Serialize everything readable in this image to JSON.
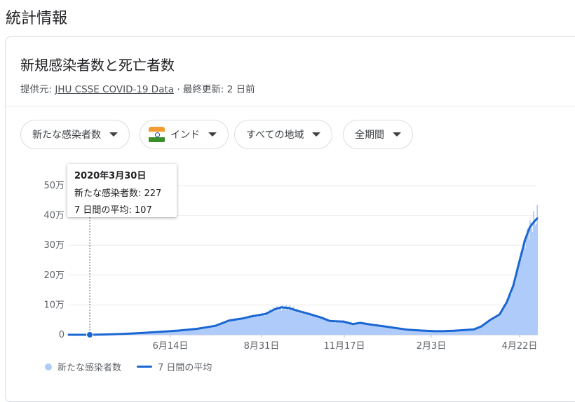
{
  "page": {
    "title": "統計情報"
  },
  "card": {
    "title": "新規感染者数と死亡者数",
    "source_prefix": "提供元: ",
    "source_link": "JHU CSSE COVID-19 Data",
    "source_suffix": " · 最終更新: 2 日前"
  },
  "filters": {
    "metric": "新たな感染者数",
    "country": "インド",
    "region": "すべての地域",
    "period": "全期間"
  },
  "colors": {
    "bars": "#aecbfa",
    "avg_line": "#1a66d2",
    "grid": "#ebebeb",
    "text": "#5f6368"
  },
  "tooltip": {
    "date": "2020年3月30日",
    "new_cases_label": "新たな感染者数",
    "new_cases_value": 227,
    "avg_label": "7 日間の平均",
    "avg_value": 107,
    "new_cases_text": "新たな感染者数: 227",
    "avg_text": "7 日間の平均: 107"
  },
  "legend": {
    "bars_label": "新たな感染者数",
    "line_label": "7 日間の平均"
  },
  "chart_data": {
    "type": "area",
    "title": "",
    "ylim": [
      0,
      500000
    ],
    "y_ticks": [
      {
        "value": 0,
        "label": "0"
      },
      {
        "value": 100000,
        "label": "10万"
      },
      {
        "value": 200000,
        "label": "20万"
      },
      {
        "value": 300000,
        "label": "30万"
      },
      {
        "value": 400000,
        "label": "40万"
      },
      {
        "value": 500000,
        "label": "50万"
      }
    ],
    "x_ticks": [
      "6月14日",
      "8月31日",
      "11月17日",
      "2月3日",
      "4月22日"
    ],
    "x_range_days": [
      0,
      393
    ],
    "x_tick_days": [
      105,
      183,
      261,
      339,
      417
    ],
    "series": [
      {
        "name": "7 日間の平均",
        "points": [
          [
            0,
            0
          ],
          [
            23,
            100
          ],
          [
            40,
            1000
          ],
          [
            60,
            3000
          ],
          [
            80,
            6000
          ],
          [
            100,
            10000
          ],
          [
            120,
            14000
          ],
          [
            140,
            20000
          ],
          [
            160,
            30000
          ],
          [
            175,
            48000
          ],
          [
            190,
            55000
          ],
          [
            200,
            62000
          ],
          [
            215,
            70000
          ],
          [
            225,
            86000
          ],
          [
            232,
            92000
          ],
          [
            240,
            90000
          ],
          [
            250,
            80000
          ],
          [
            262,
            70000
          ],
          [
            275,
            58000
          ],
          [
            285,
            46000
          ],
          [
            300,
            44000
          ],
          [
            310,
            36000
          ],
          [
            318,
            40000
          ],
          [
            330,
            34000
          ],
          [
            345,
            28000
          ],
          [
            358,
            22000
          ],
          [
            370,
            17000
          ],
          [
            385,
            14000
          ],
          [
            400,
            12000
          ],
          [
            410,
            12500
          ],
          [
            420,
            13500
          ],
          [
            432,
            16000
          ],
          [
            442,
            18000
          ],
          [
            450,
            28000
          ],
          [
            460,
            50000
          ],
          [
            470,
            68000
          ],
          [
            478,
            110000
          ],
          [
            485,
            165000
          ],
          [
            492,
            250000
          ],
          [
            498,
            320000
          ],
          [
            503,
            360000
          ],
          [
            508,
            380000
          ],
          [
            511,
            390000
          ]
        ]
      }
    ],
    "highlight_day": 23
  }
}
